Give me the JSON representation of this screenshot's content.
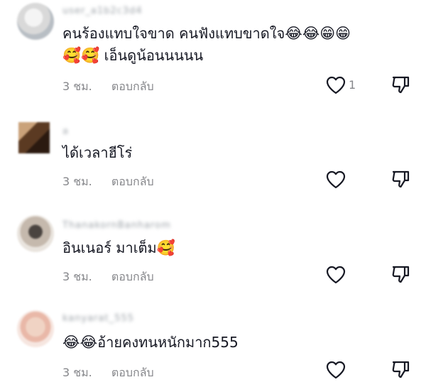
{
  "comments": [
    {
      "username": "user_a1b2c3d4",
      "text": "คนร้องแทบใจขาด คนฟังแทบขาดใจ",
      "emojis_line1": "😂😂😁😁",
      "emojis_line2": "🥰🥰",
      "text_line2": " เอ็นดูน้อนนนนน",
      "time": "3 ชม.",
      "reply": "ตอบกลับ",
      "likes": "1"
    },
    {
      "username": "ล",
      "text": "ได้เวลาฮีโร่",
      "time": "3 ชม.",
      "reply": "ตอบกลับ",
      "likes": ""
    },
    {
      "username": "ThanakornBanharom",
      "text": "อินเนอร์ มาเต็ม",
      "emojis": "🥰",
      "time": "3 ชม.",
      "reply": "ตอบกลับ",
      "likes": ""
    },
    {
      "username": "kanyarat_555",
      "emojis": "😂😂",
      "text": "อ้ายคงทนหนักมาก555",
      "time": "3 ชม.",
      "reply": "ตอบกลับ",
      "likes": ""
    }
  ],
  "icons": {
    "like": "heart-outline-icon",
    "dislike": "thumbs-down-outline-icon"
  },
  "colors": {
    "text": "#161823",
    "meta": "#86878b"
  }
}
